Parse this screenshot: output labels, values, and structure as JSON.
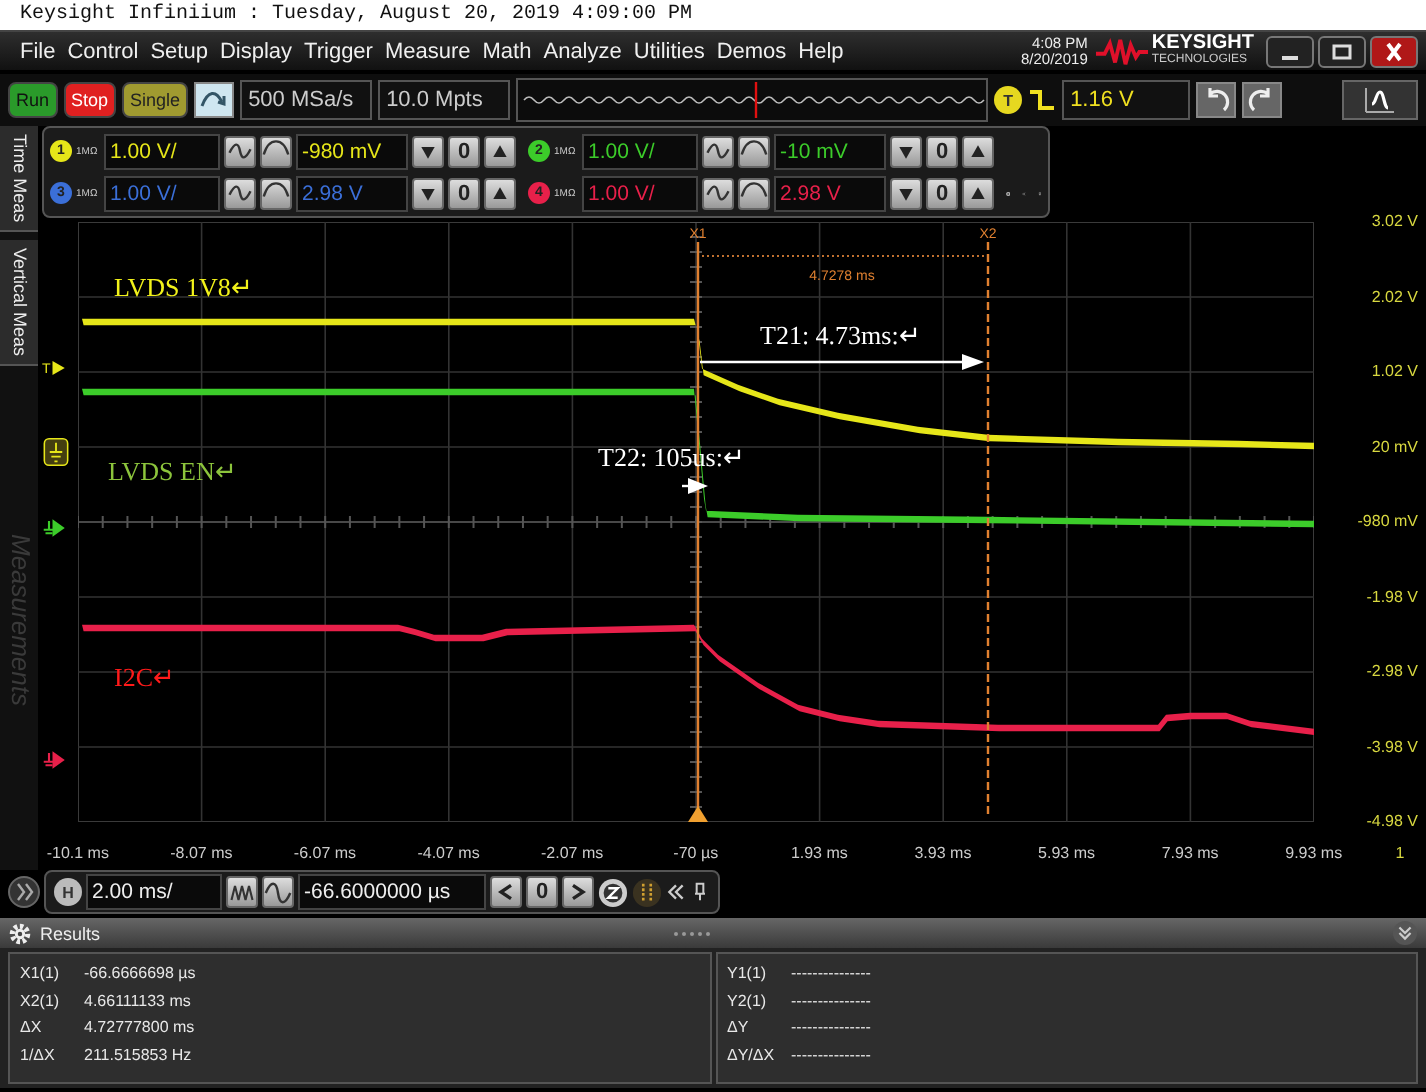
{
  "window": {
    "title": "Keysight Infiniium : Tuesday, August 20, 2019 4:09:00 PM"
  },
  "menu": [
    "File",
    "Control",
    "Setup",
    "Display",
    "Trigger",
    "Measure",
    "Math",
    "Analyze",
    "Utilities",
    "Demos",
    "Help"
  ],
  "clock": {
    "time": "4:08 PM",
    "date": "8/20/2019"
  },
  "logo": {
    "name": "KEYSIGHT",
    "subtitle": "TECHNOLOGIES"
  },
  "toolbar": {
    "buttons": [
      {
        "label": "Run",
        "kind": "run"
      },
      {
        "label": "Stop",
        "kind": "stop"
      },
      {
        "label": "Single",
        "kind": "single"
      }
    ],
    "sample_rate": "500 MSa/s",
    "memory_depth": "10.0 Mpts",
    "trigger_badge": "T",
    "trigger_level": "1.16 V"
  },
  "side_tabs": [
    {
      "label": "Time Meas",
      "disabled": false
    },
    {
      "label": "Vertical Meas",
      "disabled": false
    },
    {
      "label": "Measurements",
      "disabled": true
    }
  ],
  "channels": [
    {
      "number": "1",
      "impedance": "1MΩ",
      "scale": "1.00 V/",
      "offset": "-980 mV",
      "zero": "0",
      "color": "#e6e619"
    },
    {
      "number": "2",
      "impedance": "1MΩ",
      "scale": "1.00 V/",
      "offset": "-10 mV",
      "zero": "0",
      "color": "#3ccc2a"
    },
    {
      "number": "3",
      "impedance": "1MΩ",
      "scale": "1.00 V/",
      "offset": "2.98 V",
      "zero": "0",
      "color": "#3b6fd8"
    },
    {
      "number": "4",
      "impedance": "1MΩ",
      "scale": "1.00 V/",
      "offset": "2.98 V",
      "zero": "0",
      "color": "#e8204a"
    }
  ],
  "plot": {
    "annotations": [
      {
        "text": "LVDS  1V8↵",
        "color": "#f2f21a"
      },
      {
        "text": "T21: 4.73ms:↵",
        "color": "#ffffff"
      },
      {
        "text": "T22: 105us:↵",
        "color": "#ffffff"
      },
      {
        "text": "LVDS  EN↵",
        "color": "#8cc43c"
      },
      {
        "text": "I2C↵",
        "color": "#ff1a1a"
      }
    ],
    "trigger_marker": "T",
    "cursors": [
      "X1",
      "X2"
    ],
    "cursor_delta": "4.7278 ms",
    "y_labels": [
      "3.02 V",
      "2.02 V",
      "1.02 V",
      "20 mV",
      "-980 mV",
      "-1.98 V",
      "-2.98 V",
      "-3.98 V",
      "-4.98 V"
    ],
    "x_labels": [
      "-10.1 ms",
      "-8.07 ms",
      "-6.07 ms",
      "-4.07 ms",
      "-2.07 ms",
      "-70 µs",
      "1.93 ms",
      "3.93 ms",
      "5.93 ms",
      "7.93 ms",
      "9.93 ms"
    ],
    "x_edge": "1"
  },
  "horizontal": {
    "badge": "H",
    "scale": "2.00 ms/",
    "position": "-66.6000000 µs",
    "zero": "0"
  },
  "results": {
    "title": "Results",
    "left": [
      {
        "name": "X1(1)",
        "value": "-66.6666698 µs"
      },
      {
        "name": "X2(1)",
        "value": "4.66111133 ms"
      },
      {
        "name": "ΔX",
        "value": "4.72777800 ms"
      },
      {
        "name": "1/ΔX",
        "value": "211.515853 Hz"
      }
    ],
    "right": [
      {
        "name": "Y1(1)",
        "value": "---------------"
      },
      {
        "name": "Y2(1)",
        "value": "---------------"
      },
      {
        "name": "ΔY",
        "value": "---------------"
      },
      {
        "name": "ΔY/ΔX",
        "value": "---------------"
      }
    ]
  }
}
